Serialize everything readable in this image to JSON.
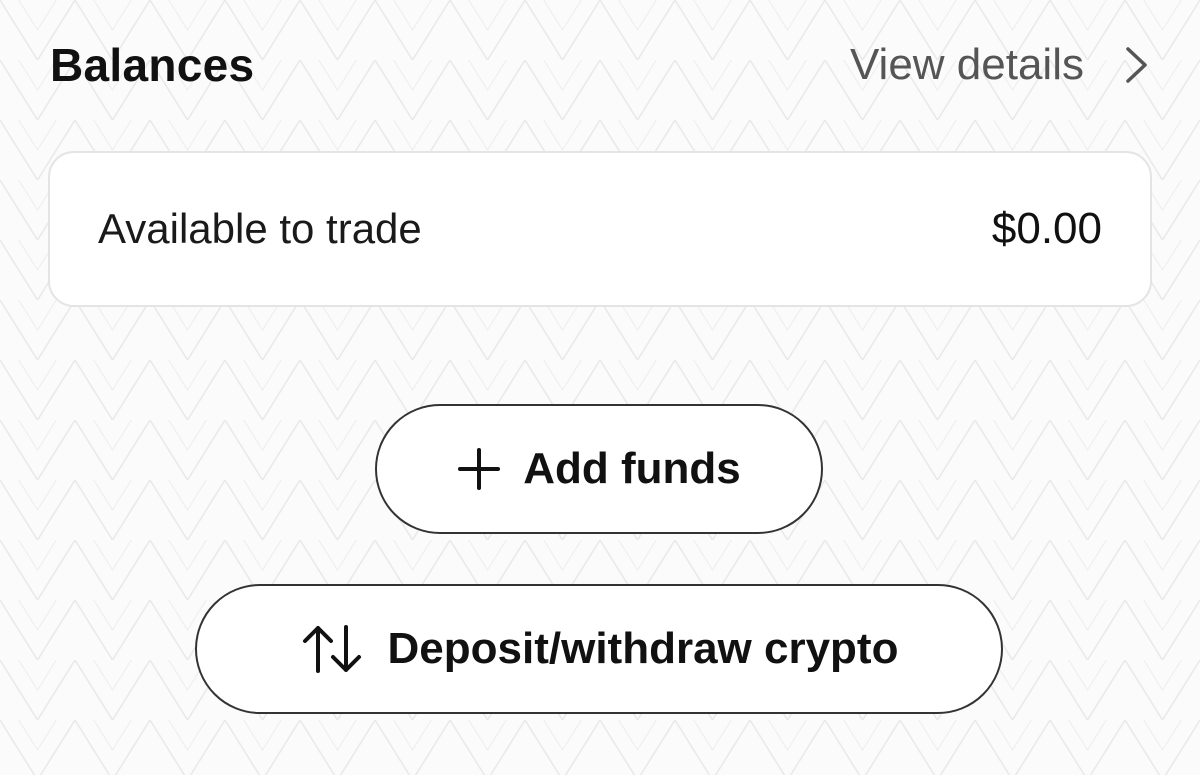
{
  "header": {
    "title": "Balances",
    "view_details_label": "View details",
    "chevron_icon": "chevron-right-icon"
  },
  "balance_card": {
    "label": "Available to trade",
    "value": "$0.00"
  },
  "actions": {
    "add_funds": {
      "label": "Add funds",
      "icon": "plus-icon"
    },
    "deposit_withdraw": {
      "label": "Deposit/withdraw crypto",
      "icon": "arrows-up-down-icon"
    }
  },
  "colors": {
    "background": "#fbfbfb",
    "card_background": "#ffffff",
    "text": "#111111",
    "muted_text": "#555555",
    "button_border": "#333333"
  }
}
